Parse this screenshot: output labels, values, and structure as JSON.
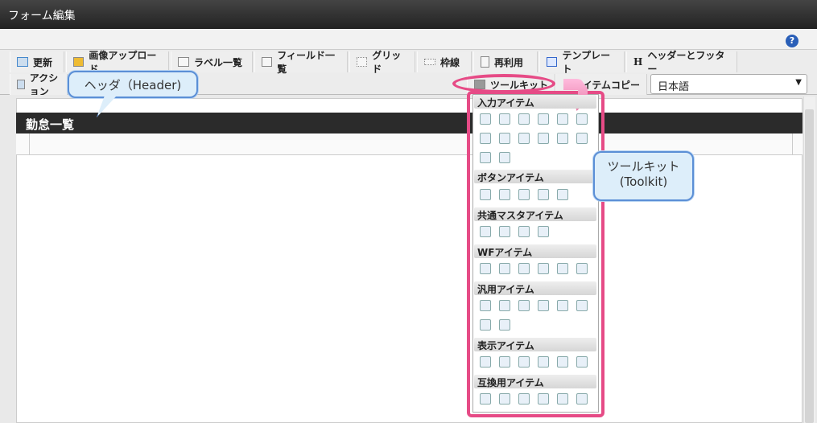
{
  "window": {
    "title": "フォーム編集"
  },
  "help_label": "?",
  "toolbar": {
    "row1": [
      "更新",
      "画像アップロード",
      "ラベル一覧",
      "フィールド一覧",
      "グリッド",
      "枠線",
      "再利用",
      "テンプレート",
      "ヘッダーとフッター"
    ],
    "row2": {
      "action": "アクション",
      "toolkit": "ツールキット",
      "item_copy": "アイテムコピー"
    },
    "language": "日本語"
  },
  "list": {
    "title": "勤怠一覧"
  },
  "toolkit": {
    "sections": [
      "入力アイテム",
      "ボタンアイテム",
      "共通マスタアイテム",
      "WFアイテム",
      "汎用アイテム",
      "表示アイテム",
      "互換用アイテム"
    ]
  },
  "callouts": {
    "header": "ヘッダ（Header)",
    "toolkit_line1": "ツールキット",
    "toolkit_line2": "(Toolkit)"
  },
  "colors": {
    "highlight": "#e64b86",
    "callout_border": "#5b8fd6"
  }
}
